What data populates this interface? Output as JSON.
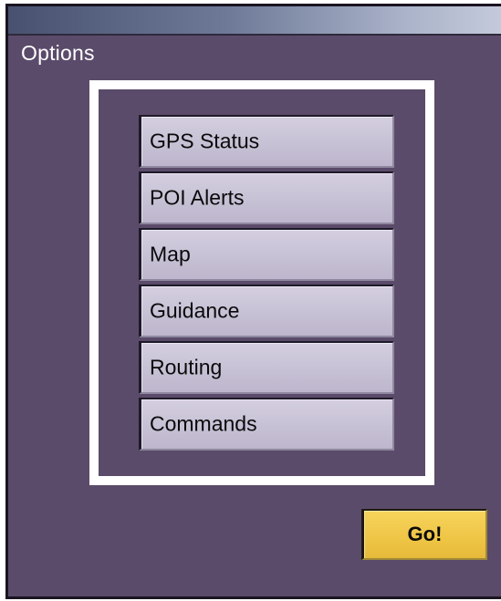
{
  "window": {
    "title": "Options"
  },
  "menu": {
    "items": [
      {
        "label": "GPS Status"
      },
      {
        "label": "POI Alerts"
      },
      {
        "label": "Map"
      },
      {
        "label": "Guidance"
      },
      {
        "label": "Routing"
      },
      {
        "label": "Commands"
      }
    ]
  },
  "actions": {
    "go_label": "Go!"
  },
  "colors": {
    "background": "#5b4b6a",
    "menu_button": "#c7c1d5",
    "go_button": "#efc545",
    "panel_border": "#ffffff"
  }
}
